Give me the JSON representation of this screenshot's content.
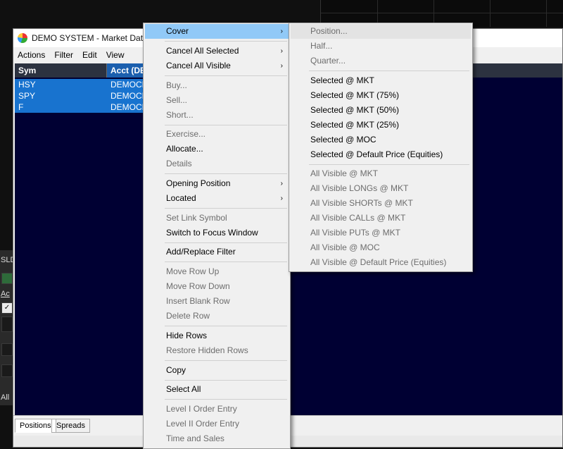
{
  "window": {
    "title": "DEMO SYSTEM - Market Data D",
    "menus": [
      "Actions",
      "Filter",
      "Edit",
      "View"
    ]
  },
  "table": {
    "columns": [
      "Sym",
      "Acct (DE"
    ],
    "rows": [
      {
        "sym": "HSY",
        "acct": "DEMOCH"
      },
      {
        "sym": "SPY",
        "acct": "DEMOCH"
      },
      {
        "sym": "F",
        "acct": "DEMOCH"
      }
    ]
  },
  "bottom_tabs": [
    "Positions",
    "Spreads"
  ],
  "left_strip_labels": [
    "SLD",
    "Ac",
    "All"
  ],
  "context_menu": {
    "items": [
      {
        "label": "Cover",
        "submenu": true,
        "enabled": true,
        "highlighted": true
      },
      {
        "label": "Cancel All Selected",
        "submenu": true,
        "enabled": true
      },
      {
        "label": "Cancel All Visible",
        "submenu": true,
        "enabled": true
      },
      {
        "label": "Buy...",
        "enabled": false
      },
      {
        "label": "Sell...",
        "enabled": false
      },
      {
        "label": "Short...",
        "enabled": false
      },
      {
        "label": "Exercise...",
        "enabled": false
      },
      {
        "label": "Allocate...",
        "enabled": true
      },
      {
        "label": "Details",
        "enabled": false
      },
      {
        "label": "Opening Position",
        "submenu": true,
        "enabled": true
      },
      {
        "label": "Located",
        "submenu": true,
        "enabled": true
      },
      {
        "label": "Set Link Symbol",
        "enabled": false
      },
      {
        "label": "Switch to Focus Window",
        "enabled": true
      },
      {
        "label": "Add/Replace Filter",
        "enabled": true
      },
      {
        "label": "Move Row Up",
        "enabled": false
      },
      {
        "label": "Move Row Down",
        "enabled": false
      },
      {
        "label": "Insert Blank Row",
        "enabled": false
      },
      {
        "label": "Delete Row",
        "enabled": false
      },
      {
        "label": "Hide Rows",
        "enabled": true
      },
      {
        "label": "Restore Hidden Rows",
        "enabled": false
      },
      {
        "label": "Copy",
        "enabled": true
      },
      {
        "label": "Select All",
        "enabled": true
      },
      {
        "label": "Level I Order Entry",
        "enabled": false
      },
      {
        "label": "Level II Order Entry",
        "enabled": false
      },
      {
        "label": "Time and Sales",
        "enabled": false
      }
    ]
  },
  "cover_submenu": {
    "items": [
      {
        "label": "Position...",
        "enabled": false,
        "highlighted": true
      },
      {
        "label": "Half...",
        "enabled": false
      },
      {
        "label": "Quarter...",
        "enabled": false
      },
      {
        "label": "Selected @ MKT",
        "enabled": true
      },
      {
        "label": "Selected @ MKT (75%)",
        "enabled": true
      },
      {
        "label": "Selected @ MKT (50%)",
        "enabled": true
      },
      {
        "label": "Selected @ MKT (25%)",
        "enabled": true
      },
      {
        "label": "Selected @ MOC",
        "enabled": true
      },
      {
        "label": "Selected @ Default Price (Equities)",
        "enabled": true
      },
      {
        "label": "All Visible @ MKT",
        "enabled": false
      },
      {
        "label": "All Visible LONGs @ MKT",
        "enabled": false
      },
      {
        "label": "All Visible SHORTs @ MKT",
        "enabled": false
      },
      {
        "label": "All Visible CALLs @ MKT",
        "enabled": false
      },
      {
        "label": "All Visible PUTs @ MKT",
        "enabled": false
      },
      {
        "label": "All Visible @ MOC",
        "enabled": false
      },
      {
        "label": "All Visible @ Default Price (Equities)",
        "enabled": false
      }
    ]
  },
  "colors": {
    "highlight": "#91c9f7",
    "selected_row": "#1873cf",
    "table_background": "#000033",
    "disabled_text": "#6d6d6d"
  }
}
